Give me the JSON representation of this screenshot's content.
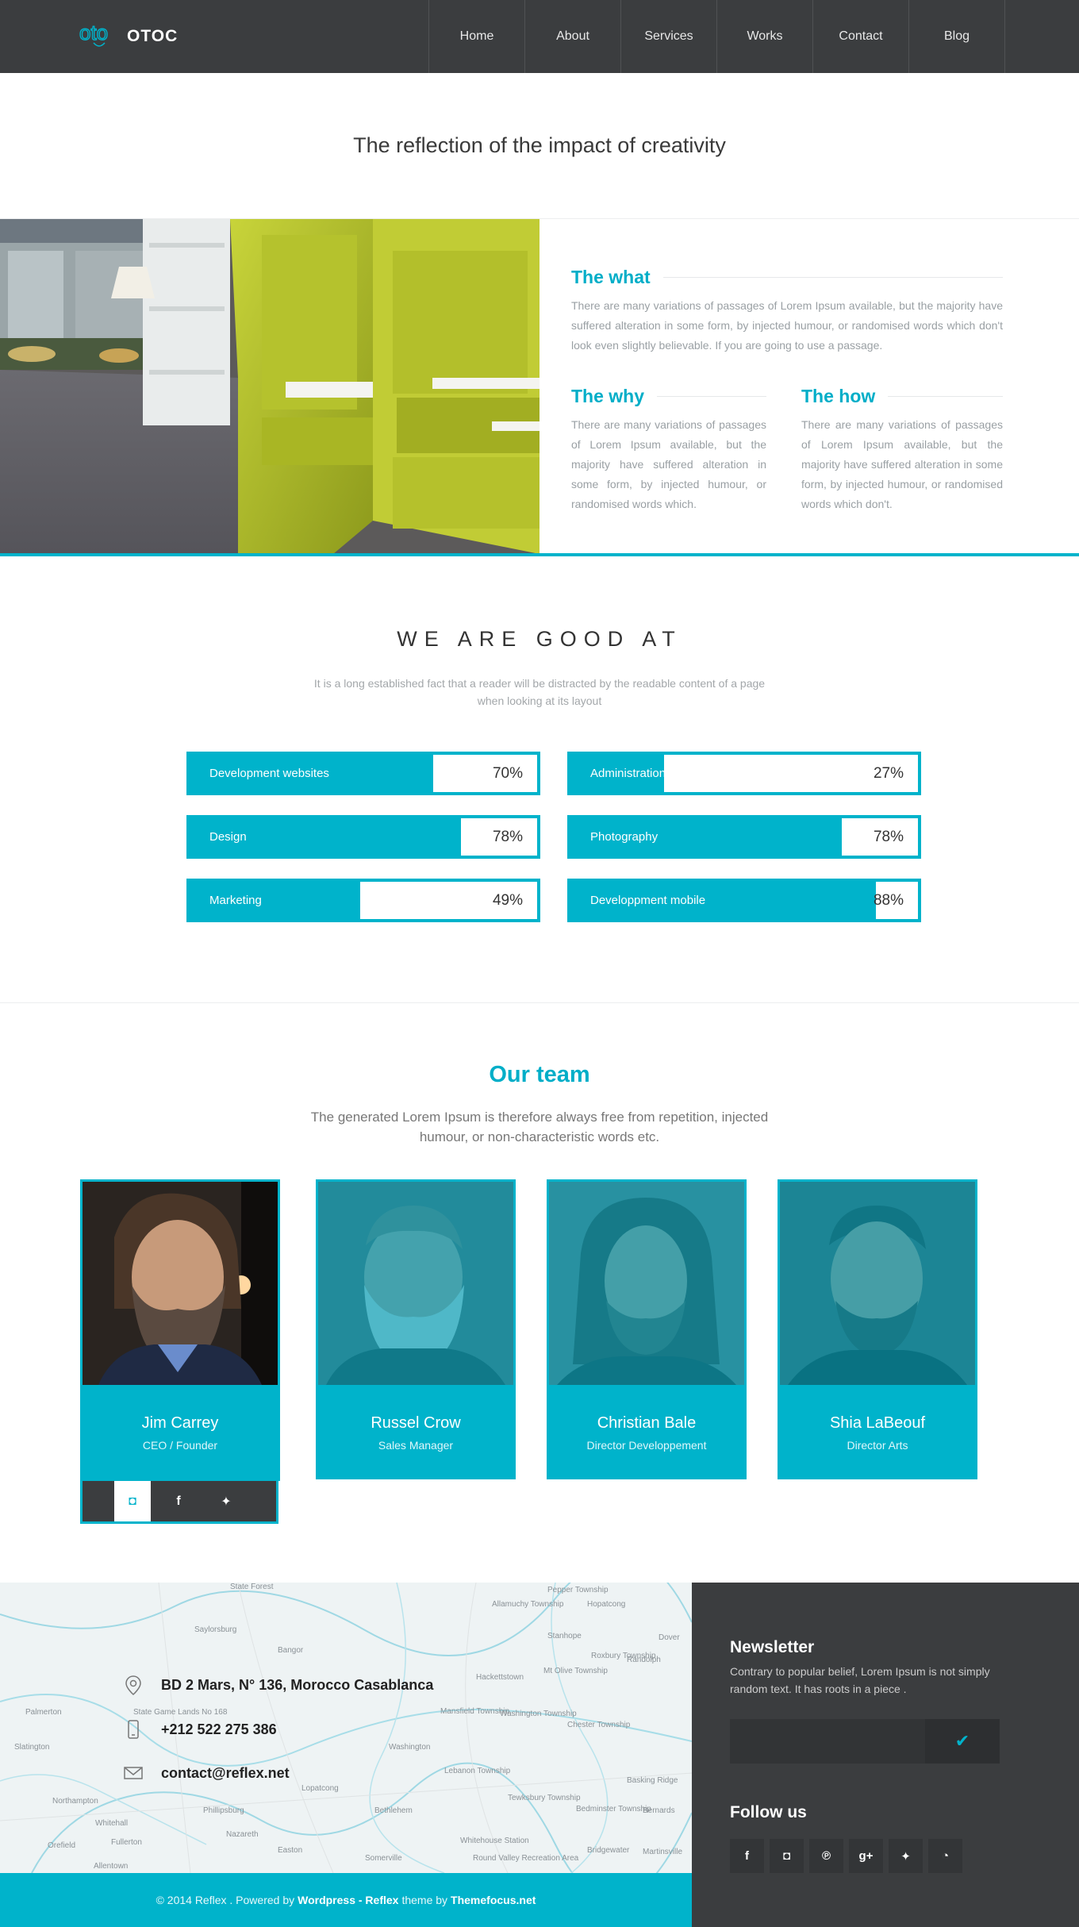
{
  "brand": {
    "name": "OTOC",
    "mark": "oto"
  },
  "nav": {
    "items": [
      "Home",
      "About",
      "Services",
      "Works",
      "Contact",
      "Blog"
    ]
  },
  "hero": {
    "title": "The reflection of the impact of creativity"
  },
  "slider": {
    "slide_count": 3,
    "active_slide": 3
  },
  "info": {
    "what": {
      "title": "The what",
      "text": "There are many variations of passages of Lorem Ipsum available, but the majority have suffered alteration in some form, by injected humour, or randomised words which don't look even slightly believable. If you are going to use a passage."
    },
    "why": {
      "title": "The why",
      "text": "There are many variations of passages of Lorem Ipsum available, but the majority have suffered alteration in some form, by injected humour, or randomised words which."
    },
    "how": {
      "title": "The how",
      "text": "There are many variations of passages of Lorem Ipsum available, but the majority have suffered alteration in some form, by injected humour, or randomised words which don't."
    }
  },
  "skills": {
    "title": "WE ARE GOOD AT",
    "subtitle": "It is a long established fact that a reader will be distracted by the readable content of a page when looking at its layout",
    "items": [
      {
        "label": "Development websites",
        "value": "70%",
        "percent": 70
      },
      {
        "label": "Administration",
        "value": "27%",
        "percent": 27
      },
      {
        "label": "Design",
        "value": "78%",
        "percent": 78
      },
      {
        "label": "Photography",
        "value": "78%",
        "percent": 78
      },
      {
        "label": "Marketing",
        "value": "49%",
        "percent": 49
      },
      {
        "label": "Developpment mobile",
        "value": "88%",
        "percent": 88
      }
    ]
  },
  "team": {
    "title": "Our team",
    "subtitle": "The generated Lorem Ipsum is therefore always free from repetition, injected humour, or non-characteristic words etc.",
    "members": [
      {
        "name": "Jim Carrey",
        "role": "CEO / Founder"
      },
      {
        "name": "Russel Crow",
        "role": "Sales Manager"
      },
      {
        "name": "Christian Bale",
        "role": "Director Developpement"
      },
      {
        "name": "Shia LaBeouf",
        "role": "Director Arts"
      }
    ],
    "social_icons": [
      "instagram-icon",
      "facebook-icon",
      "twitter-icon"
    ]
  },
  "contact": {
    "address": "BD 2 Mars, N° 136, Morocco Casablanca",
    "phone": "+212 522 275 386",
    "email": "contact@reflex.net",
    "map_labels": [
      "State Forest",
      "Pepper Township",
      "Allamuchy Township",
      "Hopatcong",
      "Saylorsburg",
      "Stanhope",
      "Dover",
      "Bangor",
      "Roxbury Township",
      "Randolph",
      "Hackettstown",
      "Mt Olive Township",
      "Palmerton",
      "State Game Lands No 168",
      "Washington Township",
      "Mansfield Township",
      "Chester Township",
      "Slatington",
      "Washington",
      "Lebanon Township",
      "Lopatcong",
      "Basking Ridge",
      "Northampton",
      "Tewksbury Township",
      "Whitehall",
      "Bethlehem",
      "Phillipsburg",
      "Bedminster Township",
      "Bernards",
      "Orefield",
      "Fullerton",
      "Nazareth",
      "Easton",
      "Somerville",
      "Bridgewater",
      "Martinsville",
      "Allentown",
      "Whitehouse Station",
      "Round Valley Recreation Area"
    ]
  },
  "newsletter": {
    "title": "Newsletter",
    "text": "Contrary to popular belief, Lorem Ipsum is not simply random text. It has roots in a piece .",
    "input_placeholder": "",
    "follow_title": "Follow us",
    "follow_icons": [
      "facebook-icon",
      "instagram-icon",
      "pinterest-icon",
      "google-plus-icon",
      "twitter-icon",
      "rss-icon"
    ]
  },
  "footer": {
    "copy_prefix": "© 2014 Reflex . Powered by",
    "wp": "Wordpress - Reflex",
    "theme_by": "theme by",
    "themefocus": "Themefocus.net"
  },
  "colors": {
    "accent": "#00b3cb",
    "dark": "#3b3d3f",
    "text_muted": "#9aa0a4"
  }
}
